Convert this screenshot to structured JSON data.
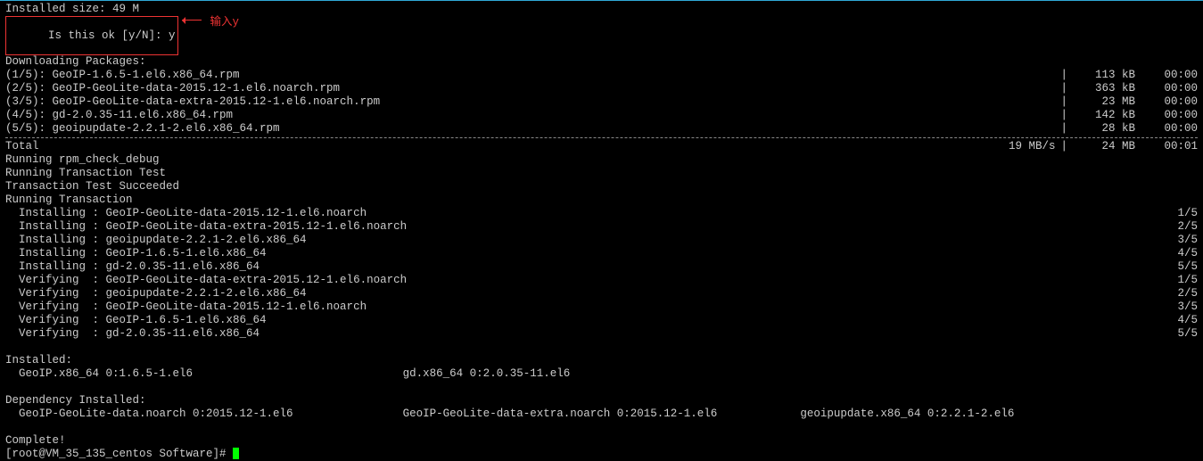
{
  "installed_size": "Installed size: 49 M",
  "prompt_line": "Is this ok [y/N]: y",
  "annotation": "输入y",
  "downloading": "Downloading Packages:",
  "packages": [
    {
      "idx": "(1/5)",
      "name": "GeoIP-1.6.5-1.el6.x86_64.rpm",
      "size": "113 kB",
      "time": "00:00"
    },
    {
      "idx": "(2/5)",
      "name": "GeoIP-GeoLite-data-2015.12-1.el6.noarch.rpm",
      "size": "363 kB",
      "time": "00:00"
    },
    {
      "idx": "(3/5)",
      "name": "GeoIP-GeoLite-data-extra-2015.12-1.el6.noarch.rpm",
      "size": "23 MB",
      "time": "00:00"
    },
    {
      "idx": "(4/5)",
      "name": "gd-2.0.35-11.el6.x86_64.rpm",
      "size": "142 kB",
      "time": "00:00"
    },
    {
      "idx": "(5/5)",
      "name": "geoipupdate-2.2.1-2.el6.x86_64.rpm",
      "size": "28 kB",
      "time": "00:00"
    }
  ],
  "total_label": "Total",
  "total_speed": "19 MB/s",
  "total_size": "24 MB",
  "total_time": "00:01",
  "rpm_check": "Running rpm_check_debug",
  "ttest": "Running Transaction Test",
  "ttest_ok": "Transaction Test Succeeded",
  "running_tx": "Running Transaction",
  "tx_steps": [
    {
      "action": "Installing",
      "pkg": "GeoIP-GeoLite-data-2015.12-1.el6.noarch",
      "counter": "1/5"
    },
    {
      "action": "Installing",
      "pkg": "GeoIP-GeoLite-data-extra-2015.12-1.el6.noarch",
      "counter": "2/5"
    },
    {
      "action": "Installing",
      "pkg": "geoipupdate-2.2.1-2.el6.x86_64",
      "counter": "3/5"
    },
    {
      "action": "Installing",
      "pkg": "GeoIP-1.6.5-1.el6.x86_64",
      "counter": "4/5"
    },
    {
      "action": "Installing",
      "pkg": "gd-2.0.35-11.el6.x86_64",
      "counter": "5/5"
    },
    {
      "action": "Verifying ",
      "pkg": "GeoIP-GeoLite-data-extra-2015.12-1.el6.noarch",
      "counter": "1/5"
    },
    {
      "action": "Verifying ",
      "pkg": "geoipupdate-2.2.1-2.el6.x86_64",
      "counter": "2/5"
    },
    {
      "action": "Verifying ",
      "pkg": "GeoIP-GeoLite-data-2015.12-1.el6.noarch",
      "counter": "3/5"
    },
    {
      "action": "Verifying ",
      "pkg": "GeoIP-1.6.5-1.el6.x86_64",
      "counter": "4/5"
    },
    {
      "action": "Verifying ",
      "pkg": "gd-2.0.35-11.el6.x86_64",
      "counter": "5/5"
    }
  ],
  "installed_hdr": "Installed:",
  "installed_cols": [
    "  GeoIP.x86_64 0:1.6.5-1.el6",
    "gd.x86_64 0:2.0.35-11.el6",
    ""
  ],
  "dep_hdr": "Dependency Installed:",
  "dep_cols": [
    "  GeoIP-GeoLite-data.noarch 0:2015.12-1.el6",
    "GeoIP-GeoLite-data-extra.noarch 0:2015.12-1.el6",
    "geoipupdate.x86_64 0:2.2.1-2.el6"
  ],
  "complete": "Complete!",
  "shell_prompt": "[root@VM_35_135_centos Software]# "
}
